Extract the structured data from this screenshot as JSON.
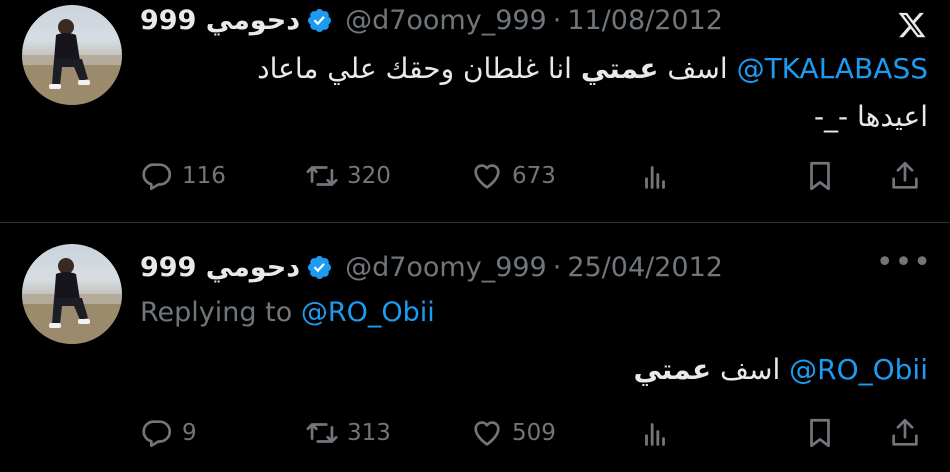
{
  "tweets": [
    {
      "name": "دحومي 999",
      "handle": "@d7oomy_999",
      "date": "11/08/2012",
      "body_mention": "@TKALABASS",
      "body_text_pre": " اسف ",
      "body_text_bold": "عمتي",
      "body_text_post": " انا غلطان وحقك علي ماعاد",
      "body_line2": "اعيدها -_-",
      "replies": "116",
      "retweets": "320",
      "likes": "673",
      "top_icon": "x-logo-icon"
    },
    {
      "name": "دحومي 999",
      "handle": "@d7oomy_999",
      "date": "25/04/2012",
      "replying_label": "Replying to",
      "replying_to": "@RO_Obii",
      "body_mention": "@RO_Obii",
      "body_text_pre": " اسف ",
      "body_text_bold": "عمتي",
      "replies": "9",
      "retweets": "313",
      "likes": "509",
      "top_icon": "more-options-icon",
      "more_glyph": "•••"
    }
  ],
  "separator": "·",
  "colors": {
    "background": "#000000",
    "text": "#e7e9ea",
    "muted": "#71767b",
    "accent": "#1d9bf0",
    "divider": "#2f3336"
  }
}
